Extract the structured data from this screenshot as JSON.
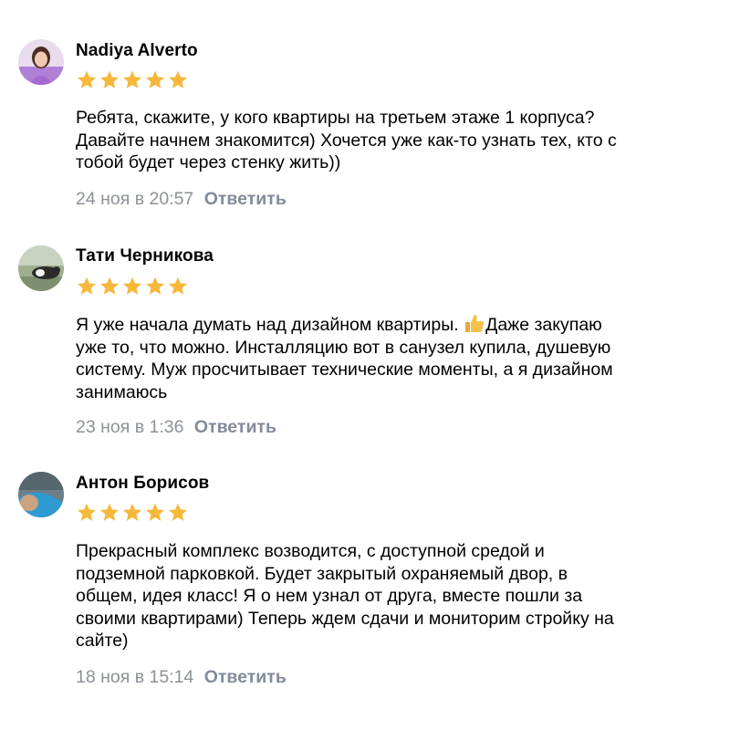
{
  "comments": [
    {
      "author": "Nadiya Alverto",
      "rating": 5,
      "lines": [
        "Ребята, скажите, у кого квартиры на третьем этаже 1 корпуса?",
        "Давайте начнем знакомится) Хочется уже как-то узнать тех, кто с",
        "тобой будет через стенку жить))"
      ],
      "date": "24 ноя в 20:57",
      "reply_label": "Ответить"
    },
    {
      "author": "Тати Черникова",
      "rating": 5,
      "lines": [
        "Я уже начала думать над дизайном квартиры.",
        "Даже закупаю",
        "уже то, что можно. Инсталляцию вот в санузел купила, душевую",
        "систему. Муж просчитывает технические моменты, а я дизайном",
        "занимаюсь"
      ],
      "date": "23 ноя в 1:36",
      "reply_label": "Ответить"
    },
    {
      "author": "Антон Борисов",
      "rating": 5,
      "lines": [
        "Прекрасный комплекс возводится, с доступной средой и",
        "подземной парковкой. Будет закрытый охраняемый двор, в",
        "общем, идея класс! Я о нем узнал от друга, вместе пошли за",
        "своими квартирами) Теперь ждем сдачи и мониторим стройку на",
        "сайте)"
      ],
      "date": "18 ноя в 15:14",
      "reply_label": "Ответить"
    }
  ],
  "colors": {
    "star": "#f5b83a",
    "date": "#8c9198",
    "reply": "#828b99",
    "text": "#000000"
  },
  "icons": {
    "star": "star-icon",
    "thumb": "thumbs-up-emoji-icon"
  }
}
